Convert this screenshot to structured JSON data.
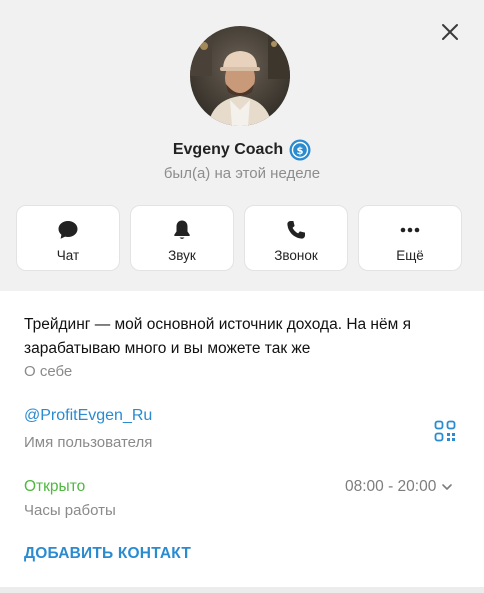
{
  "profile": {
    "name": "Evgeny Coach",
    "status": "был(а) на этой неделе",
    "verified_color": "#2a8bd0"
  },
  "actions": [
    {
      "label": "Чат",
      "icon": "chat-bubble-icon"
    },
    {
      "label": "Звук",
      "icon": "bell-icon"
    },
    {
      "label": "Звонок",
      "icon": "phone-icon"
    },
    {
      "label": "Ещё",
      "icon": "more-dots-icon"
    }
  ],
  "info": {
    "bio": "Трейдинг — мой основной источник дохода. На нём я зарабатываю много и вы можете так же",
    "bio_label": "О себе",
    "username": "@ProfitEvgen_Ru",
    "username_label": "Имя пользователя",
    "open_status": "Открыто",
    "hours": "08:00 - 20:00",
    "hours_label": "Часы работы",
    "add_contact": "ДОБАВИТЬ КОНТАКТ"
  },
  "colors": {
    "accent": "#2a8bd0",
    "open_green": "#4eb83f",
    "background": "#f1f1f1"
  }
}
